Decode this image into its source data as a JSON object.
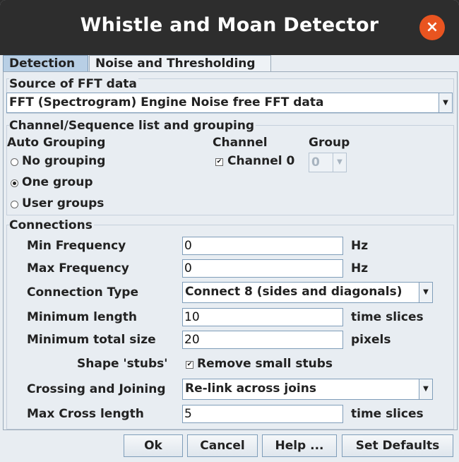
{
  "window": {
    "title": "Whistle and Moan Detector",
    "close_icon": "×"
  },
  "tabs": [
    {
      "label": "Detection",
      "active": true
    },
    {
      "label": "Noise and Thresholding",
      "active": false
    }
  ],
  "source": {
    "title": "Source of FFT data",
    "selected": "FFT (Spectrogram) Engine Noise free FFT data",
    "arrow": "▼"
  },
  "channels": {
    "title": "Channel/Sequence list and grouping",
    "auto_grouping_label": "Auto Grouping",
    "options": [
      {
        "label": "No grouping",
        "selected": false
      },
      {
        "label": "One group",
        "selected": true
      },
      {
        "label": "User groups",
        "selected": false
      }
    ],
    "channel_header": "Channel",
    "group_header": "Group",
    "channel_label": "Channel 0",
    "channel_checked": true,
    "group_value": "0",
    "check_mark": "✔",
    "arrow": "▼"
  },
  "connections": {
    "title": "Connections",
    "min_freq_label": "Min Frequency",
    "min_freq_value": "0",
    "min_freq_unit": "Hz",
    "max_freq_label": "Max Frequency",
    "max_freq_value": "0",
    "max_freq_unit": "Hz",
    "conn_type_label": "Connection Type",
    "conn_type_value": "Connect 8 (sides and diagonals)",
    "min_length_label": "Minimum length",
    "min_length_value": "10",
    "min_length_unit": "time slices",
    "min_total_label": "Minimum total size",
    "min_total_value": "20",
    "min_total_unit": "pixels",
    "stubs_label": "Shape 'stubs'",
    "stubs_check_label": "Remove small stubs",
    "stubs_checked": true,
    "crossing_label": "Crossing and Joining",
    "crossing_value": "Re-link across joins",
    "max_cross_label": "Max Cross length",
    "max_cross_value": "5",
    "max_cross_unit": "time slices",
    "check_mark": "✔",
    "arrow": "▼"
  },
  "buttons": {
    "ok": "Ok",
    "cancel": "Cancel",
    "help": "Help ...",
    "defaults": "Set Defaults"
  }
}
